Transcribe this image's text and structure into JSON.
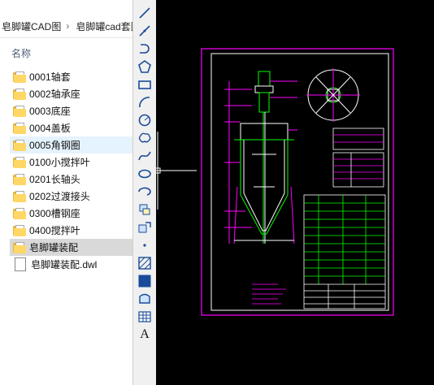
{
  "breadcrumb": {
    "items": [
      "皂脚罐CAD图",
      "皂脚罐cad套图"
    ],
    "separator": "›"
  },
  "explorer": {
    "column_header": "名称",
    "items": [
      {
        "name": "0001轴套",
        "type": "folder",
        "state": "normal"
      },
      {
        "name": "0002轴承座",
        "type": "folder",
        "state": "normal"
      },
      {
        "name": "0003底座",
        "type": "folder",
        "state": "normal"
      },
      {
        "name": "0004盖板",
        "type": "folder",
        "state": "normal"
      },
      {
        "name": "0005角钢圈",
        "type": "folder",
        "state": "hover"
      },
      {
        "name": "0100小搅拌叶",
        "type": "folder",
        "state": "normal"
      },
      {
        "name": "0201长轴头",
        "type": "folder",
        "state": "normal"
      },
      {
        "name": "0202过渡接头",
        "type": "folder",
        "state": "normal"
      },
      {
        "name": "0300槽钢座",
        "type": "folder",
        "state": "normal"
      },
      {
        "name": "0400搅拌叶",
        "type": "folder",
        "state": "normal"
      },
      {
        "name": "皂脚罐装配",
        "type": "folder",
        "state": "selected"
      },
      {
        "name": "皂脚罐装配.dwl",
        "type": "file",
        "state": "normal"
      }
    ]
  },
  "toolbar": {
    "tools": [
      "line-icon",
      "polyline-icon",
      "arc-polyline-icon",
      "polygon-icon",
      "rectangle-icon",
      "arc-icon",
      "circle-icon",
      "revision-cloud-icon",
      "spline-icon",
      "ellipse-icon",
      "ellipse-arc-icon",
      "insert-block-icon",
      "make-block-icon",
      "point-icon",
      "hatch-icon",
      "gradient-icon",
      "region-icon",
      "table-icon",
      "multiline-text-icon"
    ],
    "text_tool_label": "A"
  },
  "colors": {
    "canvas_bg": "#000000",
    "sheet_border": "#ff00ff",
    "drawing_lines": "#ffffff",
    "dimension": "#ff00ff",
    "geometry": "#00ff00",
    "selection_bg": "#d9d9d9",
    "hover_bg": "#e5f3ff"
  }
}
